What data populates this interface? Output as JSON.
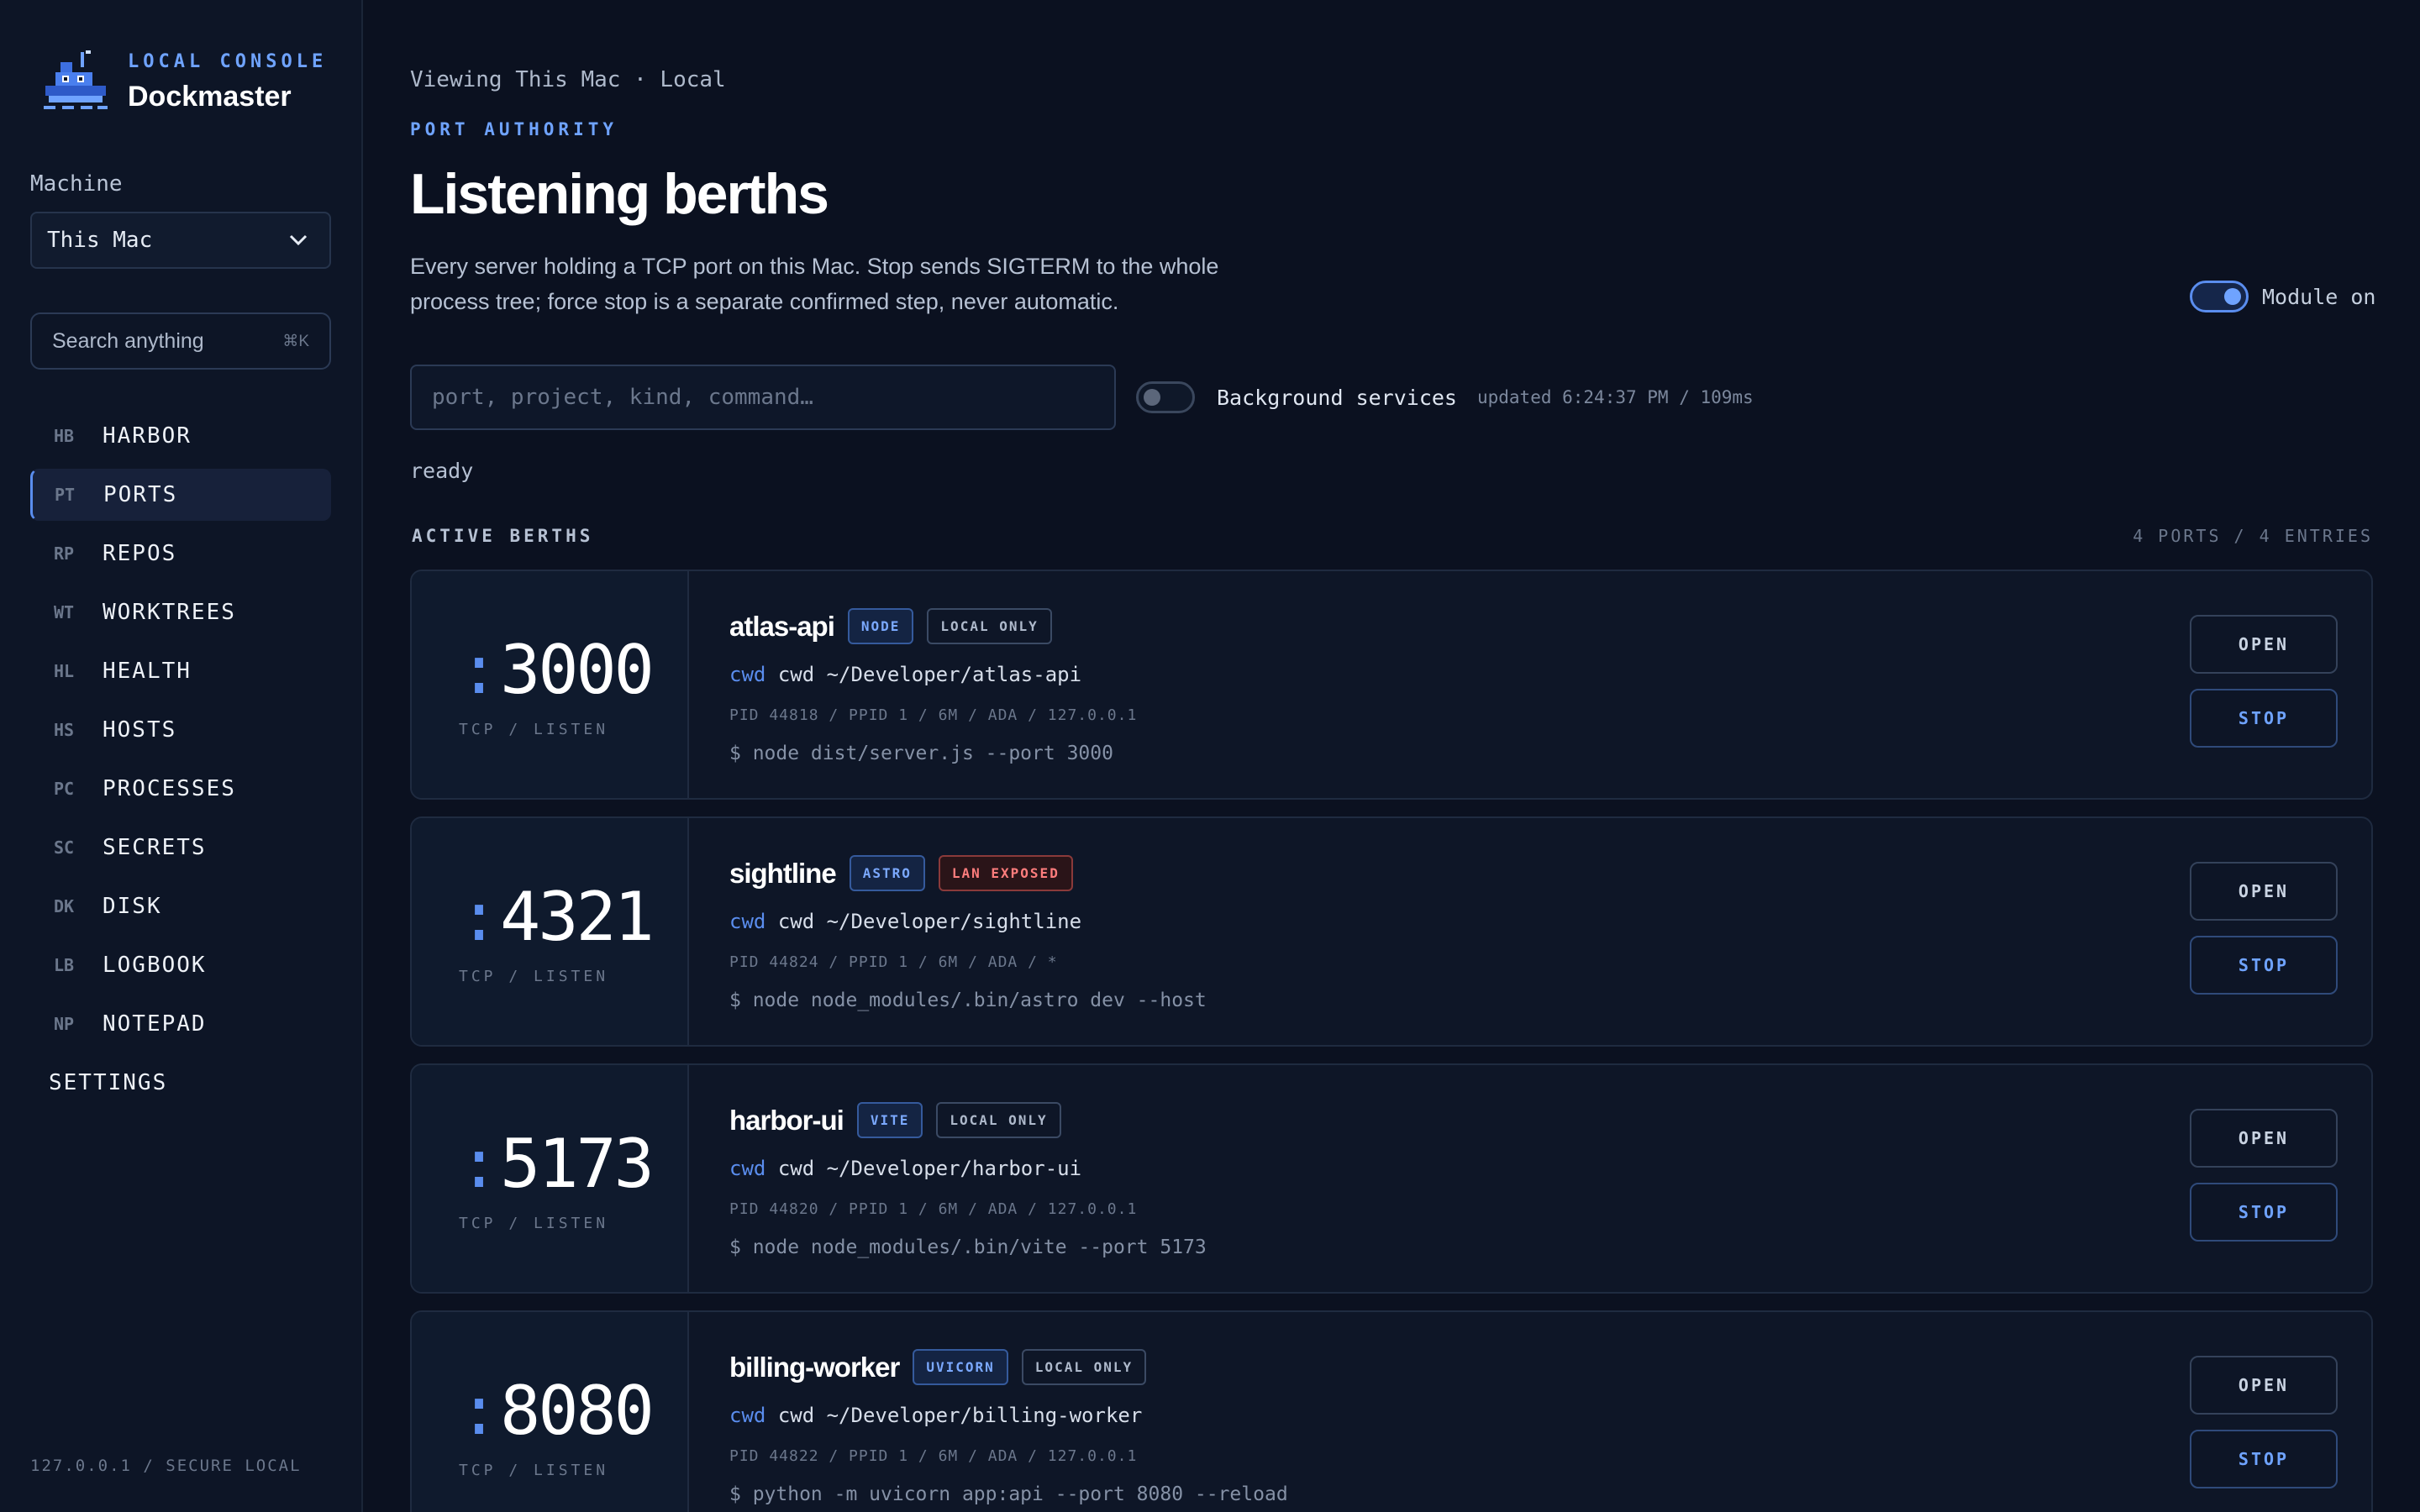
{
  "brand": {
    "kicker": "LOCAL CONSOLE",
    "name": "Dockmaster"
  },
  "sidebar": {
    "machine_label": "Machine",
    "machine_value": "This Mac",
    "search_placeholder": "Search anything",
    "search_shortcut": "⌘K",
    "items": [
      {
        "code": "HB",
        "label": "HARBOR"
      },
      {
        "code": "PT",
        "label": "PORTS"
      },
      {
        "code": "RP",
        "label": "REPOS"
      },
      {
        "code": "WT",
        "label": "WORKTREES"
      },
      {
        "code": "HL",
        "label": "HEALTH"
      },
      {
        "code": "HS",
        "label": "HOSTS"
      },
      {
        "code": "PC",
        "label": "PROCESSES"
      },
      {
        "code": "SC",
        "label": "SECRETS"
      },
      {
        "code": "DK",
        "label": "DISK"
      },
      {
        "code": "LB",
        "label": "LOGBOOK"
      },
      {
        "code": "NP",
        "label": "NOTEPAD"
      }
    ],
    "settings_label": "SETTINGS",
    "footer": "127.0.0.1 / SECURE LOCAL"
  },
  "header": {
    "breadcrumb": "Viewing This Mac · Local",
    "kicker": "PORT AUTHORITY",
    "title": "Listening berths",
    "description": "Every server holding a TCP port on this Mac. Stop sends SIGTERM to the whole process tree; force stop is a separate confirmed step, never automatic.",
    "module_label": "Module on"
  },
  "filter": {
    "placeholder": "port, project, kind, command…",
    "background_label": "Background services",
    "updated": "updated 6:24:37 PM / 109ms",
    "status": "ready"
  },
  "section": {
    "title": "ACTIVE BERTHS",
    "count": "4 PORTS / 4 ENTRIES"
  },
  "actions": {
    "open": "OPEN",
    "stop": "STOP"
  },
  "berths": [
    {
      "port": "3000",
      "proto": "TCP / LISTEN",
      "name": "atlas-api",
      "kind": "NODE",
      "scope": "LOCAL ONLY",
      "cwd_key": "cwd",
      "cwd": "cwd ~/Developer/atlas-api",
      "meta": "PID 44818 / PPID 1 / 6M / ADA / 127.0.0.1",
      "cmd": "$ node dist/server.js --port 3000"
    },
    {
      "port": "4321",
      "proto": "TCP / LISTEN",
      "name": "sightline",
      "kind": "ASTRO",
      "scope": "LAN EXPOSED",
      "cwd_key": "cwd",
      "cwd": "cwd ~/Developer/sightline",
      "meta": "PID 44824 / PPID 1 / 6M / ADA / *",
      "cmd": "$ node node_modules/.bin/astro dev --host"
    },
    {
      "port": "5173",
      "proto": "TCP / LISTEN",
      "name": "harbor-ui",
      "kind": "VITE",
      "scope": "LOCAL ONLY",
      "cwd_key": "cwd",
      "cwd": "cwd ~/Developer/harbor-ui",
      "meta": "PID 44820 / PPID 1 / 6M / ADA / 127.0.0.1",
      "cmd": "$ node node_modules/.bin/vite --port 5173"
    },
    {
      "port": "8080",
      "proto": "TCP / LISTEN",
      "name": "billing-worker",
      "kind": "UVICORN",
      "scope": "LOCAL ONLY",
      "cwd_key": "cwd",
      "cwd": "cwd ~/Developer/billing-worker",
      "meta": "PID 44822 / PPID 1 / 6M / ADA / 127.0.0.1",
      "cmd": "$ python -m uvicorn app:api --port 8080 --reload"
    }
  ]
}
